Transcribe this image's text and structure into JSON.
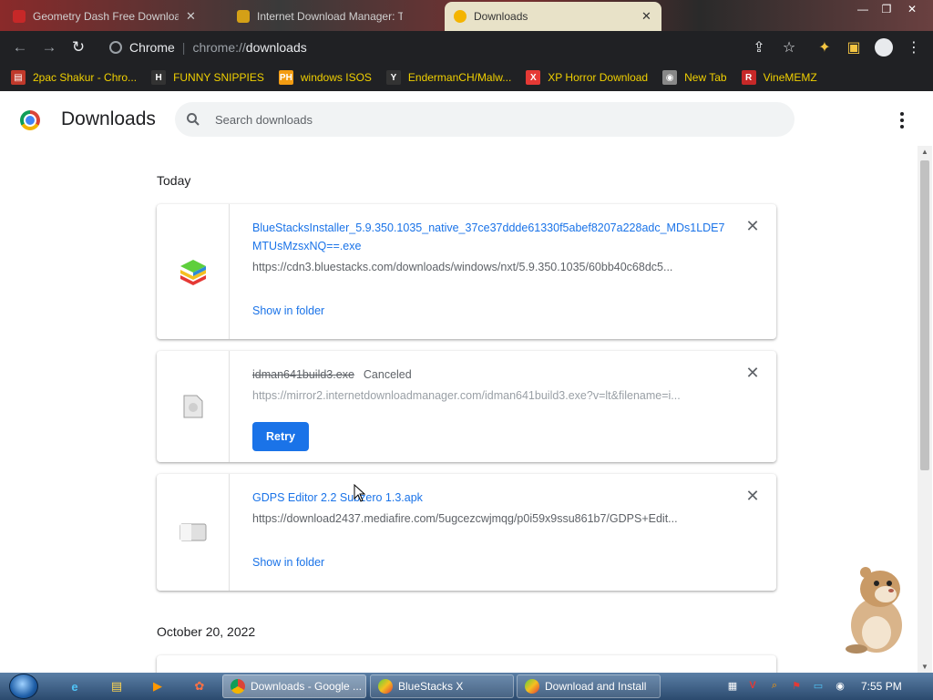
{
  "tabs": [
    {
      "label": "Geometry Dash Free Download"
    },
    {
      "label": "Internet Download Manager: T"
    },
    {
      "label": "Downloads"
    }
  ],
  "toolbar": {
    "site_label": "Chrome",
    "url_scheme": "chrome://",
    "url_path": "downloads"
  },
  "bookmarks": [
    {
      "label": "2pac Shakur - Chro...",
      "icon": "stack-icon",
      "color": "#c0392b"
    },
    {
      "label": "FUNNY SNIPPIES",
      "icon": "h-icon",
      "color": "#333333"
    },
    {
      "label": "windows ISOS",
      "icon": "ph-icon",
      "color": "#f39c12"
    },
    {
      "label": "EndermanCH/Malw...",
      "icon": "yp-icon",
      "color": "#333333"
    },
    {
      "label": "XP Horror Download",
      "icon": "x-icon",
      "color": "#e53935"
    },
    {
      "label": "New Tab",
      "icon": "globe-icon",
      "color": "#888888"
    },
    {
      "label": "VineMEMZ",
      "icon": "r-icon",
      "color": "#c62828"
    }
  ],
  "page": {
    "title": "Downloads",
    "search_placeholder": "Search downloads"
  },
  "sections": {
    "today": "Today",
    "older": "October 20, 2022"
  },
  "downloads": [
    {
      "name": "BlueStacksInstaller_5.9.350.1035_native_37ce37ddde61330f5abef8207a228adc_MDs1LDE7MTUsMzsxNQ==.exe",
      "url": "https://cdn3.bluestacks.com/downloads/windows/nxt/5.9.350.1035/60bb40c68dc5...",
      "action": "Show in folder"
    },
    {
      "name": "idman641build3.exe",
      "status": "Canceled",
      "url": "https://mirror2.internetdownloadmanager.com/idman641build3.exe?v=lt&filename=i...",
      "action": "Retry"
    },
    {
      "name": "GDPS Editor 2.2 Subzero 1.3.apk",
      "url": "https://download2437.mediafire.com/5ugcezcwjmqg/p0i59x9ssu861b7/GDPS+Edit...",
      "action": "Show in folder"
    }
  ],
  "taskbar": {
    "buttons": [
      {
        "label": "Downloads - Google ..."
      },
      {
        "label": "BlueStacks X"
      },
      {
        "label": "Download and Install"
      }
    ],
    "clock": "7:55 PM"
  }
}
